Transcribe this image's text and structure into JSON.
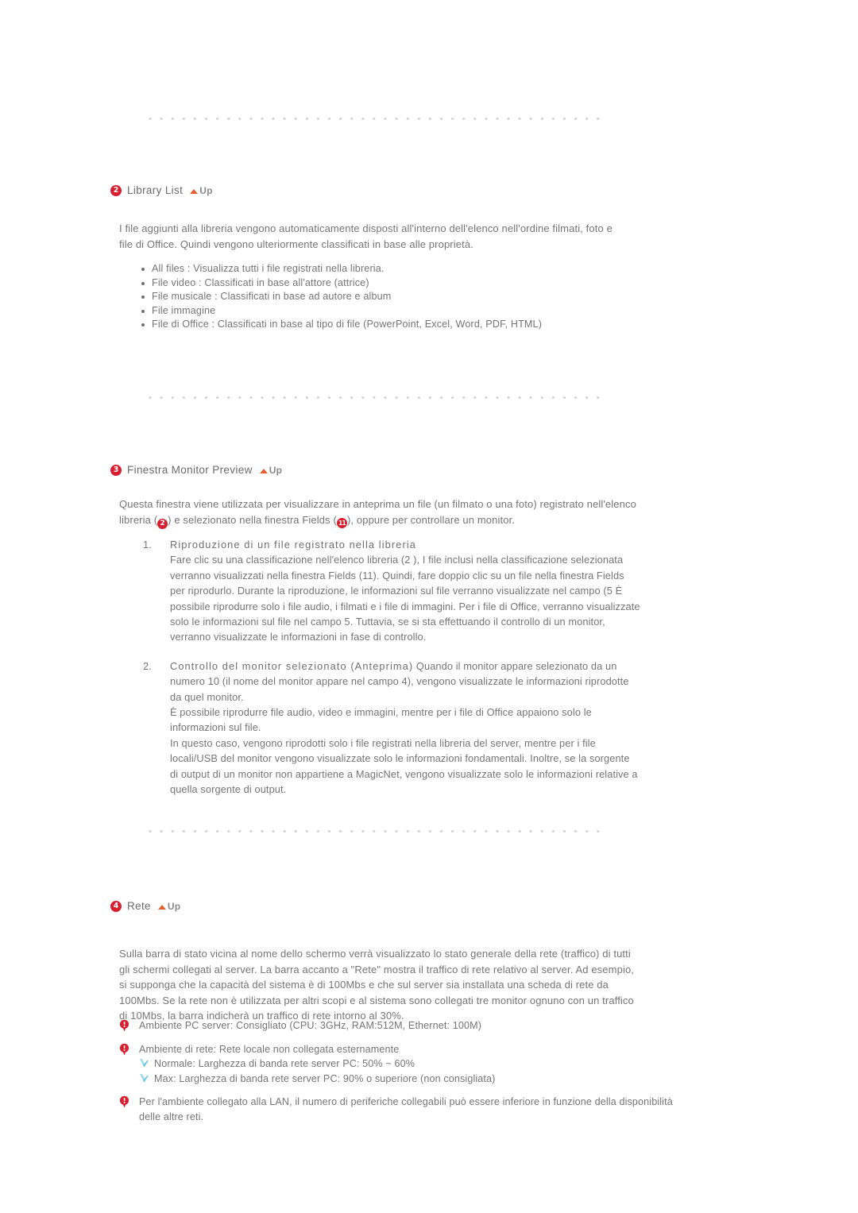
{
  "meta": {
    "accent_red": "#d81f30",
    "body_text_color": "#757575",
    "divider_color": "#d4d4d4",
    "up_triangle_color": "#e2622f",
    "tick_color": "#8fd4f0"
  },
  "up_link": {
    "label": "Up",
    "icon": "triangle-up-icon"
  },
  "dividers": [
    {
      "name": "divider-top"
    },
    {
      "name": "divider-middle"
    },
    {
      "name": "divider-bottom"
    }
  ],
  "sections": [
    {
      "number": "2",
      "title": "Library List",
      "intro": "I file aggiunti alla libreria vengono automaticamente disposti all'interno dell'elenco nell'ordine filmati, foto e file di Office. Quindi vengono ulteriormente classificati in base alle proprietà.",
      "bullets": [
        "All files : Visualizza tutti i file registrati nella libreria.",
        "File video : Classificati in base all'attore (attrice)",
        "File musicale : Classificati in base ad autore e album",
        "File immagine",
        "File di Office : Classificati in base al tipo di file (PowerPoint, Excel, Word, PDF, HTML)"
      ]
    },
    {
      "number": "3",
      "title": "Finestra Monitor Preview",
      "intro_parts": {
        "p1": "Questa finestra viene utilizzata per visualizzare in anteprima un file (un filmato o una foto) registrato nell'elenco libreria (",
        "badge1": "2",
        "p2": ") e selezionato nella finestra Fields (",
        "badge2": "11",
        "p3": "), oppure per controllare un monitor."
      },
      "steps": [
        {
          "num": "1.",
          "title": "Riproduzione di un file registrato nella libreria",
          "body_parts": {
            "t1": "Fare clic su una classificazione nell'elenco libreria (",
            "b1": "2",
            "t2": " ), I file inclusi nella classificazione selezionata verranno visualizzati nella finestra Fields (",
            "b2": "11",
            "t3": "). Quindi, fare doppio clic su un file nella finestra Fields per riprodurlo. Durante la riproduzione, le informazioni sul file verranno visualizzate nel campo (",
            "b3": "5",
            "t4": " È possibile riprodurre solo i file audio, i filmati e i file di immagini. Per i file di Office, verranno visualizzate solo le informazioni sul file nel campo",
            "b4": "5",
            "t5": ". Tuttavia, se si sta effettuando il controllo di un monitor, verranno visualizzate le informazioni in fase di controllo."
          }
        },
        {
          "num": "2.",
          "title": "Controllo del monitor selezionato (Anteprima)",
          "body_parts": {
            "t1": " Quando il monitor appare selezionato da un numero",
            "b1": "10",
            "t2": "(il nome del monitor appare nel campo",
            "b2": "4",
            "t3": "), vengono visualizzate le informazioni riprodotte da quel monitor.",
            "t4": "È possibile riprodurre file audio, video e immagini, mentre per i file di Office appaiono solo le informazioni sul file.",
            "t5": "In questo caso, vengono riprodotti solo i file registrati nella libreria del server, mentre per i file locali/USB del monitor vengono visualizzate solo le informazioni fondamentali. Inoltre, se la sorgente di output di un monitor non appartiene a MagicNet, vengono visualizzate solo le informazioni relative a quella sorgente di output."
          }
        }
      ]
    },
    {
      "number": "4",
      "title": "Rete",
      "intro": "Sulla barra di stato vicina al nome dello schermo verrà visualizzato lo stato generale della rete (traffico) di tutti gli schermi collegati al server. La barra accanto a \"Rete\" mostra il traffico di rete relativo al server. Ad esempio, si supponga che la capacità del sistema è di 100Mbs e che sul server sia installata una scheda di rete da 100Mbs. Se la rete non è utilizzata per altri scopi e al sistema sono collegati tre monitor ognuno con un traffico di 10Mbs, la barra indicherà un traffico di rete intorno al 30%.",
      "notes": [
        {
          "icon": "warning-icon",
          "text": "Ambiente PC server: Consigliato (CPU: 3GHz, RAM:512M, Ethernet: 100M)",
          "subnotes": []
        },
        {
          "icon": "warning-icon",
          "text": "Ambiente di rete: Rete locale non collegata esternamente",
          "subnotes": [
            "Normale: Larghezza di banda rete server PC: 50% ~ 60%",
            "Max: Larghezza di banda rete server PC: 90% o superiore (non consigliata)"
          ]
        },
        {
          "icon": "warning-icon",
          "text": "Per l'ambiente collegato alla LAN, il numero di periferiche collegabili può essere inferiore in funzione della disponibilità delle altre reti.",
          "subnotes": []
        }
      ]
    }
  ]
}
